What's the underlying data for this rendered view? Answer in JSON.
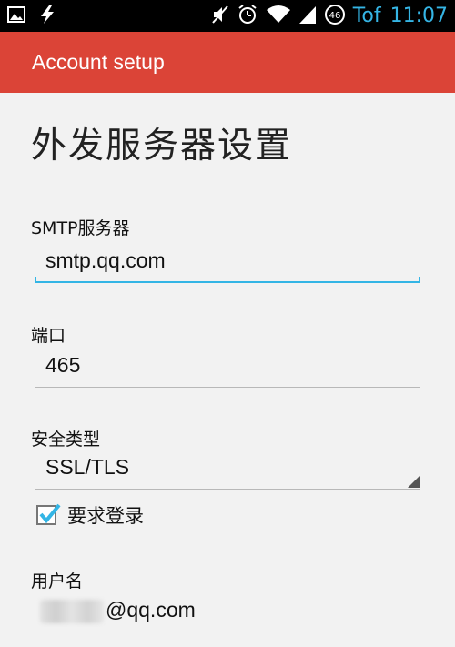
{
  "status_bar": {
    "carrier": "Tof",
    "time": "11:07",
    "badge": "46"
  },
  "action_bar": {
    "title": "Account setup"
  },
  "page": {
    "title": "外发服务器设置"
  },
  "form": {
    "smtp": {
      "label": "SMTP服务器",
      "value": "smtp.qq.com"
    },
    "port": {
      "label": "端口",
      "value": "465"
    },
    "security": {
      "label": "安全类型",
      "value": "SSL/TLS"
    },
    "require_login": {
      "label": "要求登录",
      "checked": true
    },
    "username": {
      "label": "用户名",
      "value": "@qq.com"
    }
  },
  "colors": {
    "accent": "#db4437",
    "focus": "#33b5e5",
    "clock": "#35b5e5"
  },
  "icons": [
    "image-icon",
    "flash-icon",
    "mute-icon",
    "alarm-icon",
    "wifi-icon",
    "signal-icon",
    "network-badge-icon"
  ]
}
